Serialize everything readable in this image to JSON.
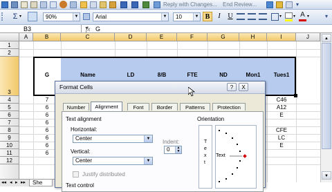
{
  "toolbar": {
    "font_name": "Arial",
    "font_size": "10",
    "zoom": "90%",
    "reply_label": "Reply with Changes...",
    "end_review_label": "End Review...",
    "bold": "B",
    "italic": "I",
    "underline": "U",
    "fill_letter": "A"
  },
  "formula_bar": {
    "name_box": "B3",
    "fx": "fx",
    "content": "G"
  },
  "columns": [
    "A",
    "B",
    "C",
    "D",
    "E",
    "F",
    "G",
    "H",
    "I",
    "J"
  ],
  "rows": [
    "1",
    "2",
    "3",
    "4",
    "5",
    "6",
    "7",
    "8",
    "9",
    "10",
    "11",
    "12"
  ],
  "header_row": {
    "b": "G",
    "c": "Name",
    "d": "LD",
    "e": "8/B",
    "f": "FTE",
    "g": "ND",
    "h": "Mon1",
    "i": "Tues1"
  },
  "col_b_values": [
    "7",
    "6",
    "6",
    "6",
    "6",
    "6",
    "6",
    "6"
  ],
  "col_i_values": [
    "C46",
    "A12",
    "E",
    "",
    "CFE",
    "LC",
    "E",
    ""
  ],
  "sheet_tab": "She",
  "dialog": {
    "title": "Format Cells",
    "help": "?",
    "close": "X",
    "tabs": [
      "Number",
      "Alignment",
      "Font",
      "Border",
      "Patterns",
      "Protection"
    ],
    "text_alignment_label": "Text alignment",
    "horizontal_label": "Horizontal:",
    "horizontal_value": "Center",
    "vertical_label": "Vertical:",
    "vertical_value": "Center",
    "indent_label": "Indent:",
    "indent_value": "0",
    "justify_label": "Justify distributed",
    "text_control_label": "Text control",
    "orientation_label": "Orientation",
    "vertical_text": [
      "T",
      "e",
      "x",
      "t"
    ],
    "dial_text": "Text"
  },
  "colors": {
    "selection": "#b6cbee",
    "accent": "#316ac5",
    "font_red": "#d40000"
  }
}
